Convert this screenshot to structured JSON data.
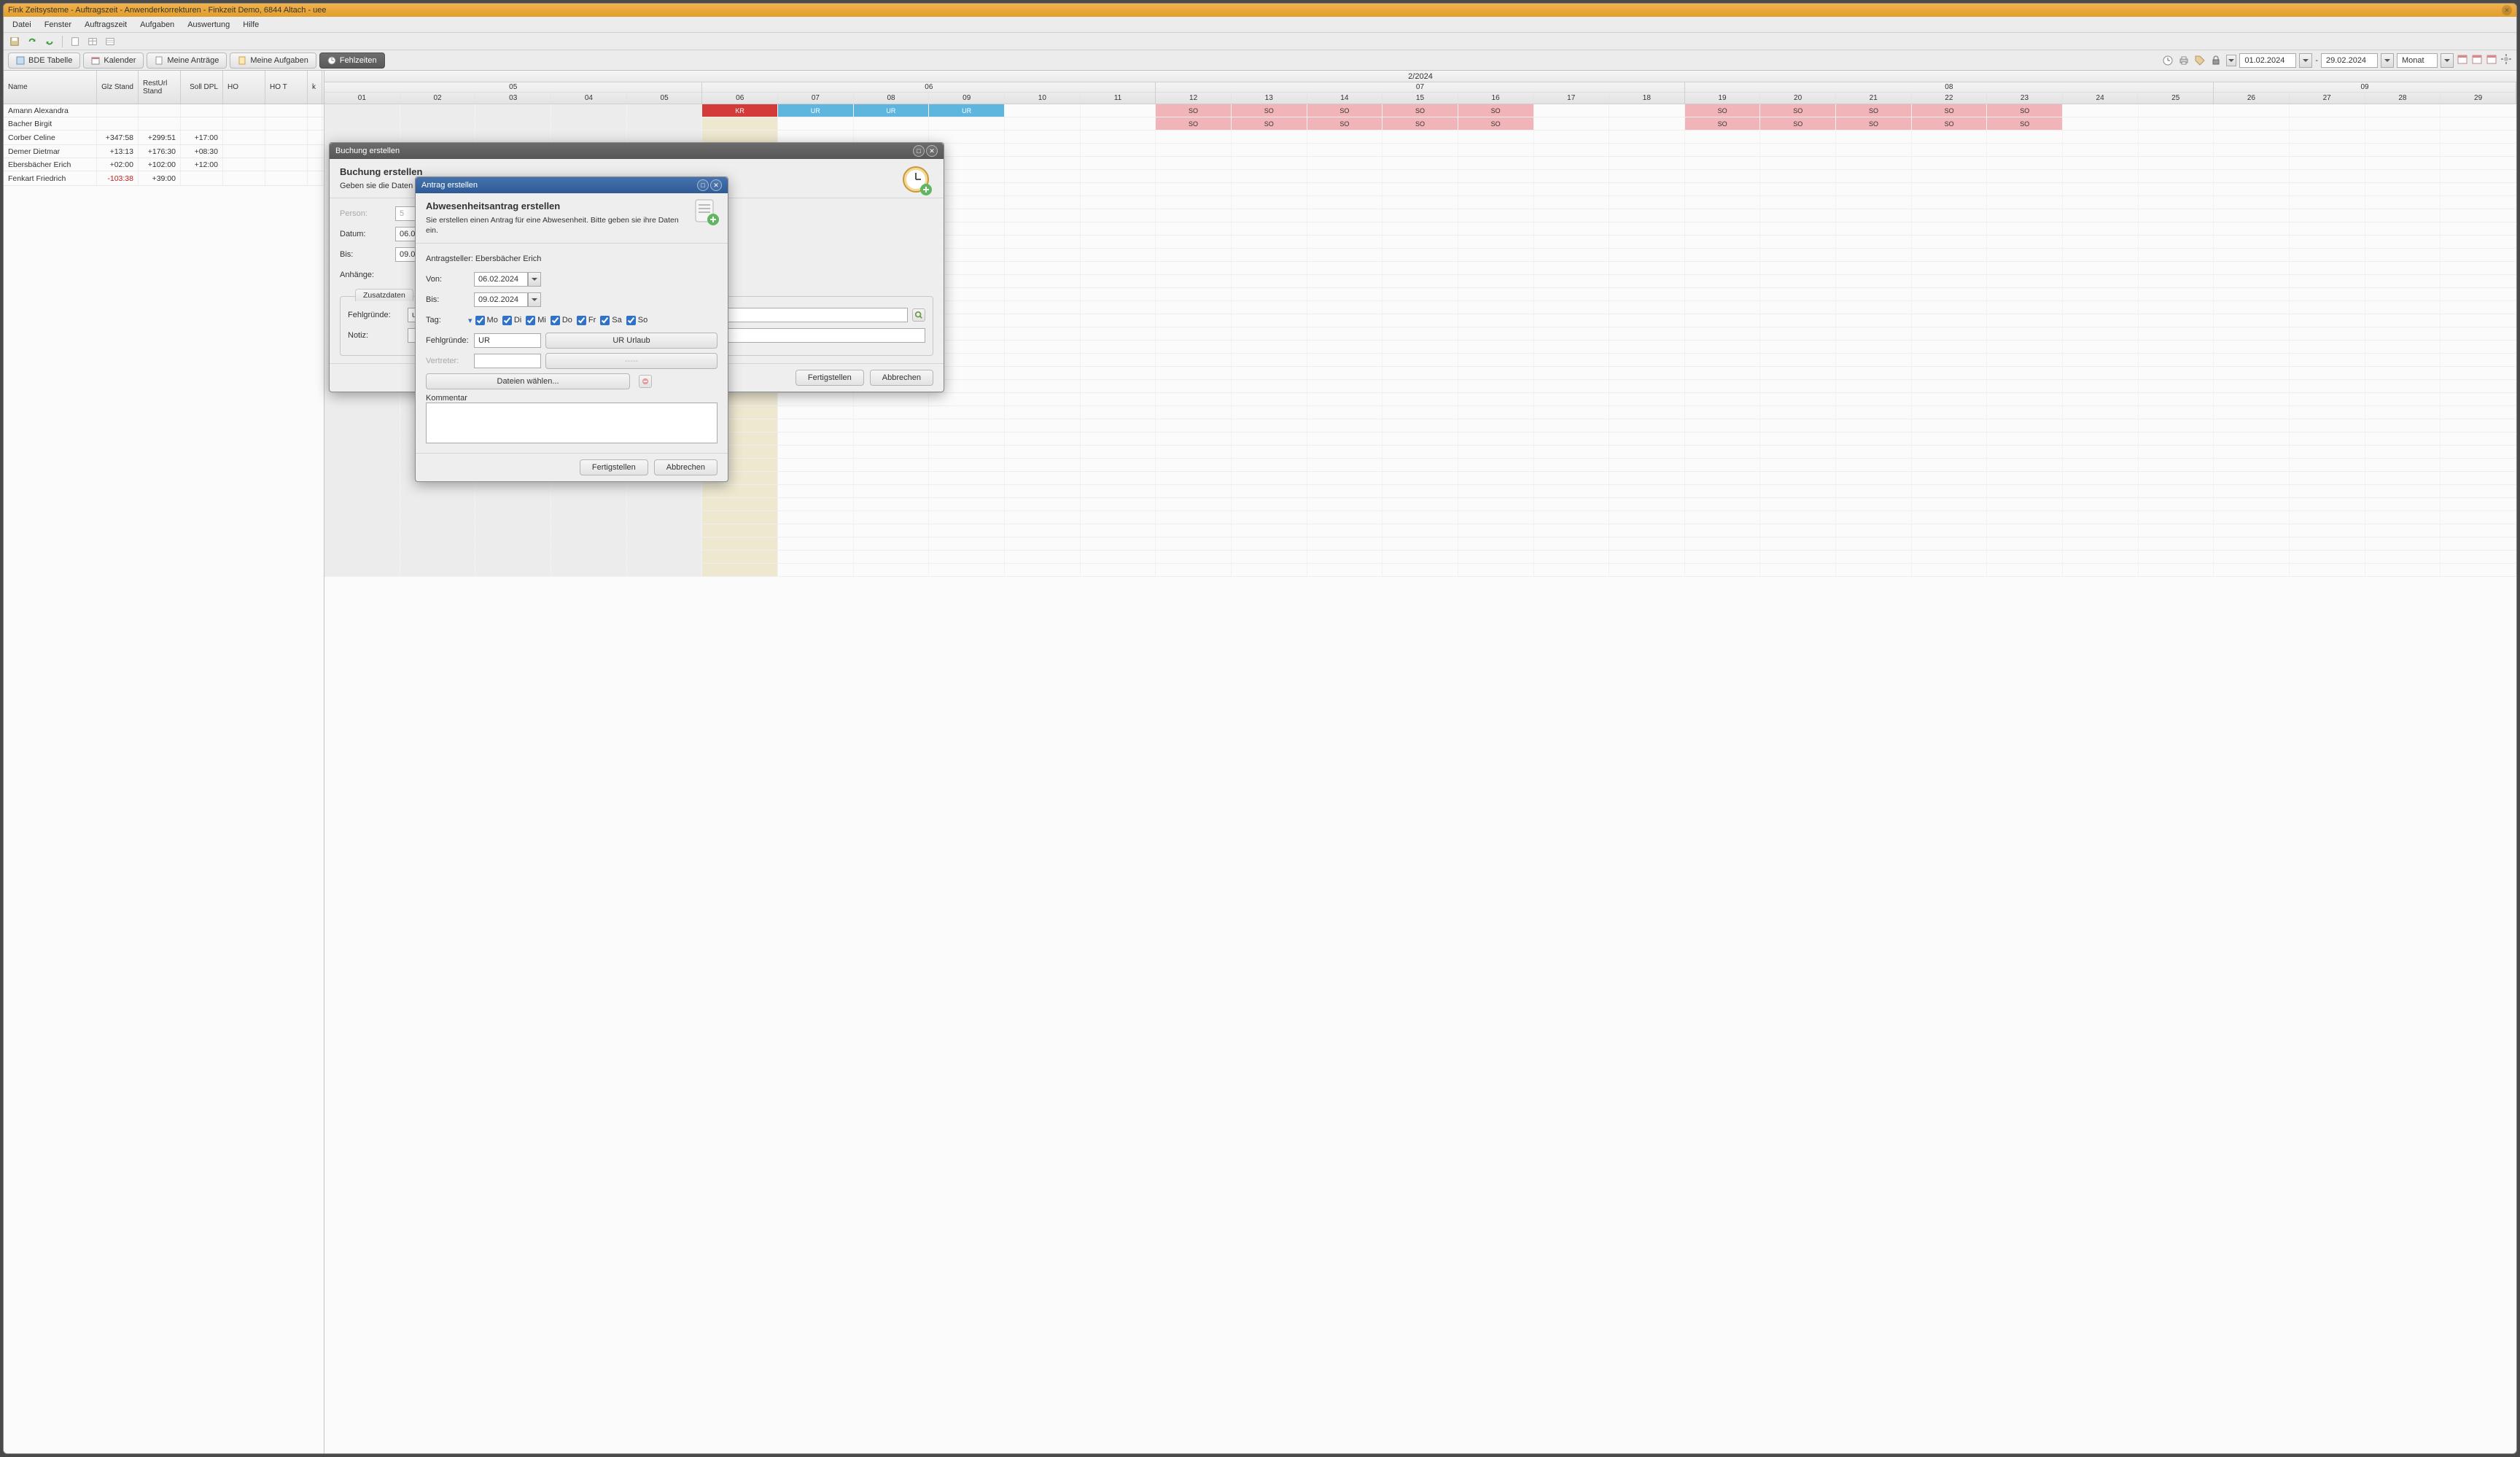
{
  "window_title": "Fink Zeitsysteme - Auftragszeit - Anwenderkorrekturen - Finkzeit Demo, 6844 Altach - uee",
  "menus": [
    "Datei",
    "Fenster",
    "Auftragszeit",
    "Aufgaben",
    "Auswertung",
    "Hilfe"
  ],
  "tabs": [
    {
      "label": "BDE Tabelle"
    },
    {
      "label": "Kalender"
    },
    {
      "label": "Meine Anträge"
    },
    {
      "label": "Meine Aufgaben"
    },
    {
      "label": "Fehlzeiten",
      "active": true
    }
  ],
  "date_range": {
    "from": "01.02.2024",
    "to": "29.02.2024",
    "unit": "Monat"
  },
  "month_label": "2/2024",
  "day_columns": {
    "05": [
      "01",
      "02",
      "03",
      "04",
      "05"
    ],
    "06": [
      "06",
      "07",
      "08",
      "09",
      "10",
      "11"
    ],
    "07": [
      "12",
      "13",
      "14",
      "15",
      "16",
      "17",
      "18"
    ],
    "08": [
      "19",
      "20",
      "21",
      "22",
      "23",
      "24",
      "25"
    ],
    "09": [
      "26",
      "27",
      "28",
      "29"
    ]
  },
  "table": {
    "headers": [
      "Name",
      "Glz Stand",
      "RestUrl Stand",
      "Soll DPL",
      "HO",
      "HO T",
      "k"
    ],
    "rows": [
      {
        "name": "Amann Alexandra",
        "glz": "",
        "rest": "",
        "soll": "",
        "ho": "",
        "hot": ""
      },
      {
        "name": "Bacher Birgit",
        "glz": "",
        "rest": "",
        "soll": "",
        "ho": "",
        "hot": ""
      },
      {
        "name": "Corber Celine",
        "glz": "+347:58",
        "rest": "+299:51",
        "soll": "+17:00",
        "ho": "",
        "hot": ""
      },
      {
        "name": "Demer Dietmar",
        "glz": "+13:13",
        "rest": "+176:30",
        "soll": "+08:30",
        "ho": "",
        "hot": ""
      },
      {
        "name": "Ebersbächer Erich",
        "glz": "+02:00",
        "rest": "+102:00",
        "soll": "+12:00",
        "ho": "",
        "hot": ""
      },
      {
        "name": "Fenkart Friedrich",
        "glz": "-103:38",
        "rest": "+39:00",
        "soll": "",
        "ho": "",
        "hot": ""
      }
    ]
  },
  "schedule": {
    "shaded_start": 5,
    "shaded_end": 5,
    "current_day_idx": 6,
    "rows": [
      {
        "kr": [
          6
        ],
        "ur": [
          7,
          8,
          9
        ],
        "so": [
          12,
          13,
          14,
          15,
          16,
          19,
          20,
          21,
          22,
          23
        ]
      },
      {
        "so": [
          12,
          13,
          14,
          15,
          16,
          19,
          20,
          21,
          22,
          23
        ]
      },
      {},
      {},
      {},
      {}
    ]
  },
  "dlg1": {
    "title": "Buchung erstellen",
    "heading": "Buchung erstellen",
    "sub": "Geben sie die Daten",
    "labels": {
      "person": "Person:",
      "datum": "Datum:",
      "bis": "Bis:",
      "anhaenge": "Anhänge:",
      "fehlg": "Fehlgründe:",
      "notiz": "Notiz:"
    },
    "person_val": "5",
    "datum_val": "06.02.2024",
    "bis_val": "09.02.202",
    "zusatz_tab": "Zusatzdaten",
    "fehlg_val": "ur",
    "done": "Fertigstellen",
    "cancel": "Abbrechen"
  },
  "dlg2": {
    "title": "Antrag erstellen",
    "heading": "Abwesenheitsantrag erstellen",
    "sub": "Sie erstellen einen Antrag für eine Abwesenheit. Bitte geben sie ihre Daten ein.",
    "applicant_label": "Antragsteller:",
    "applicant": "Ebersbächer Erich",
    "labels": {
      "von": "Von:",
      "bis": "Bis:",
      "tag": "Tag:",
      "fehlg": "Fehlgründe:",
      "vertreter": "Vertreter:",
      "kommentar": "Kommentar"
    },
    "von_val": "06.02.2024",
    "bis_val": "09.02.2024",
    "days": [
      "Mo",
      "Di",
      "Mi",
      "Do",
      "Fr",
      "Sa",
      "So"
    ],
    "fehlg_val": "UR",
    "fehlg_desc": "UR Urlaub",
    "vertreter_placeholder": "-----",
    "files_btn": "Dateien wählen...",
    "done": "Fertigstellen",
    "cancel": "Abbrechen"
  }
}
